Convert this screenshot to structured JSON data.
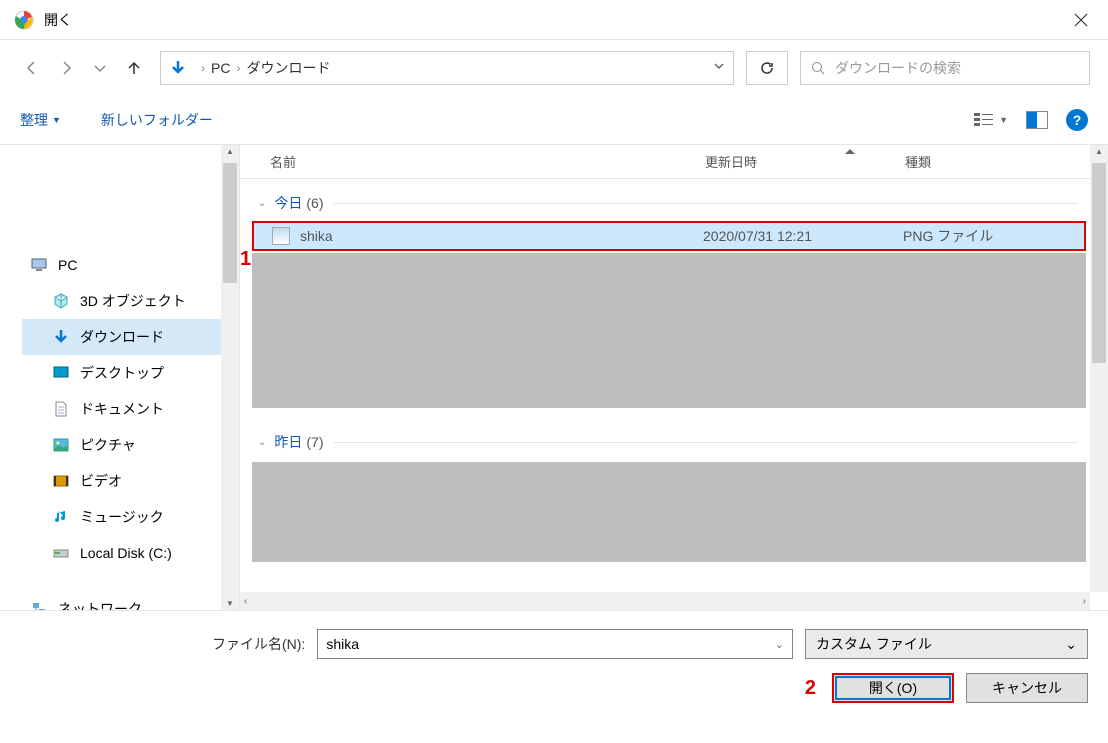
{
  "title": "開く",
  "path": {
    "root": "PC",
    "folder": "ダウンロード"
  },
  "search_placeholder": "ダウンロードの検索",
  "toolbar": {
    "organize": "整理",
    "new_folder": "新しいフォルダー"
  },
  "columns": {
    "name": "名前",
    "date": "更新日時",
    "type": "種類"
  },
  "groups": {
    "today": {
      "label": "今日",
      "count": "(6)"
    },
    "yesterday": {
      "label": "昨日",
      "count": "(7)"
    }
  },
  "file": {
    "name": "shika",
    "date": "2020/07/31 12:21",
    "type": "PNG ファイル"
  },
  "sidebar": {
    "pc": "PC",
    "items": [
      "3D オブジェクト",
      "ダウンロード",
      "デスクトップ",
      "ドキュメント",
      "ピクチャ",
      "ビデオ",
      "ミュージック",
      "Local Disk (C:)"
    ],
    "network": "ネットワーク"
  },
  "filename": {
    "label": "ファイル名(N):",
    "value": "shika"
  },
  "filter": "カスタム ファイル",
  "buttons": {
    "open": "開く(O)",
    "cancel": "キャンセル"
  },
  "annotations": {
    "one": "1",
    "two": "2"
  }
}
